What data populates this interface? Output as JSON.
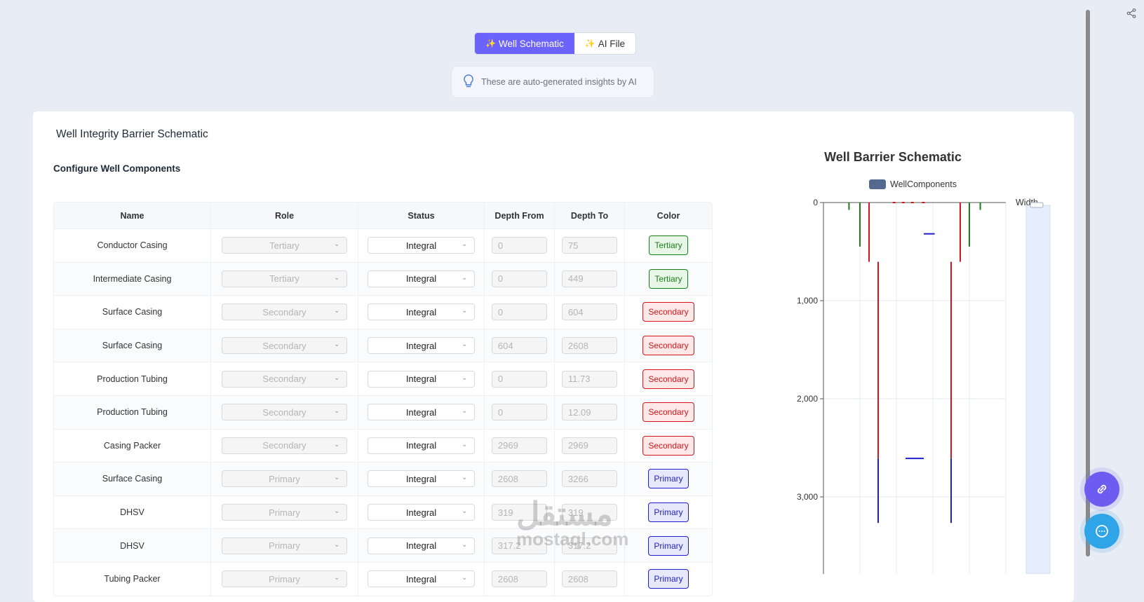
{
  "tabs": [
    {
      "label": "Well Schematic",
      "active": true
    },
    {
      "label": "AI File",
      "active": false
    }
  ],
  "insight": {
    "text": "These are auto-generated insights by AI"
  },
  "card": {
    "title": "Well Integrity Barrier Schematic",
    "section": "Configure Well Components"
  },
  "table": {
    "headers": [
      "Name",
      "Role",
      "Status",
      "Depth From",
      "Depth To",
      "Color"
    ],
    "rows": [
      {
        "name": "Conductor Casing",
        "role": "Tertiary",
        "status": "Integral",
        "from": "0",
        "to": "75",
        "color": "Tertiary"
      },
      {
        "name": "Intermediate Casing",
        "role": "Tertiary",
        "status": "Integral",
        "from": "0",
        "to": "449",
        "color": "Tertiary"
      },
      {
        "name": "Surface Casing",
        "role": "Secondary",
        "status": "Integral",
        "from": "0",
        "to": "604",
        "color": "Secondary"
      },
      {
        "name": "Surface Casing",
        "role": "Secondary",
        "status": "Integral",
        "from": "604",
        "to": "2608",
        "color": "Secondary"
      },
      {
        "name": "Production Tubing",
        "role": "Secondary",
        "status": "Integral",
        "from": "0",
        "to": "11.73",
        "color": "Secondary"
      },
      {
        "name": "Production Tubing",
        "role": "Secondary",
        "status": "Integral",
        "from": "0",
        "to": "12.09",
        "color": "Secondary"
      },
      {
        "name": "Casing Packer",
        "role": "Secondary",
        "status": "Integral",
        "from": "2969",
        "to": "2969",
        "color": "Secondary"
      },
      {
        "name": "Surface Casing",
        "role": "Primary",
        "status": "Integral",
        "from": "2608",
        "to": "3266",
        "color": "Primary"
      },
      {
        "name": "DHSV",
        "role": "Primary",
        "status": "Integral",
        "from": "319",
        "to": "319",
        "color": "Primary"
      },
      {
        "name": "DHSV",
        "role": "Primary",
        "status": "Integral",
        "from": "317.2",
        "to": "317.2",
        "color": "Primary"
      },
      {
        "name": "Tubing Packer",
        "role": "Primary",
        "status": "Integral",
        "from": "2608",
        "to": "2608",
        "color": "Primary"
      }
    ]
  },
  "colors": {
    "Tertiary": "#1a7f1a",
    "Secondary": "#d4161b",
    "Primary": "#1f1fcc",
    "accent": "#6c63ff"
  },
  "chart_data": {
    "type": "bar",
    "title": "Well Barrier Schematic",
    "legend": [
      "WellComponents"
    ],
    "xlabel": "Width",
    "ylabel": "",
    "ylim": [
      0,
      3600
    ],
    "y_ticks": [
      "0",
      "1,000",
      "2,000",
      "3,000"
    ],
    "y_tick_values": [
      0,
      1000,
      2000,
      3000
    ],
    "x_slots": 5,
    "segments": [
      {
        "side": "left",
        "col": 0.7,
        "from": 0,
        "to": 75,
        "role": "Tertiary"
      },
      {
        "side": "left",
        "col": 1.0,
        "from": 0,
        "to": 449,
        "role": "Tertiary"
      },
      {
        "side": "left",
        "col": 1.25,
        "from": 0,
        "to": 604,
        "role": "Secondary"
      },
      {
        "side": "left",
        "col": 1.5,
        "from": 604,
        "to": 2608,
        "role": "Secondary"
      },
      {
        "side": "left",
        "col": 1.5,
        "from": 2608,
        "to": 3266,
        "role": "Primary"
      },
      {
        "side": "right",
        "col": 3.5,
        "from": 604,
        "to": 2608,
        "role": "Secondary"
      },
      {
        "side": "right",
        "col": 3.5,
        "from": 2608,
        "to": 3266,
        "role": "Primary"
      },
      {
        "side": "right",
        "col": 3.75,
        "from": 0,
        "to": 604,
        "role": "Secondary"
      },
      {
        "side": "right",
        "col": 4.0,
        "from": 0,
        "to": 449,
        "role": "Tertiary"
      },
      {
        "side": "right",
        "col": 4.3,
        "from": 0,
        "to": 75,
        "role": "Tertiary"
      }
    ],
    "markers": [
      {
        "x_from": 2.75,
        "x_to": 3.05,
        "depth": 319,
        "role": "Primary"
      },
      {
        "x_from": 2.25,
        "x_to": 2.75,
        "depth": 2608,
        "role": "Primary"
      }
    ]
  },
  "watermark": {
    "arabic": "مستقل",
    "latin": "mostaql.com"
  }
}
